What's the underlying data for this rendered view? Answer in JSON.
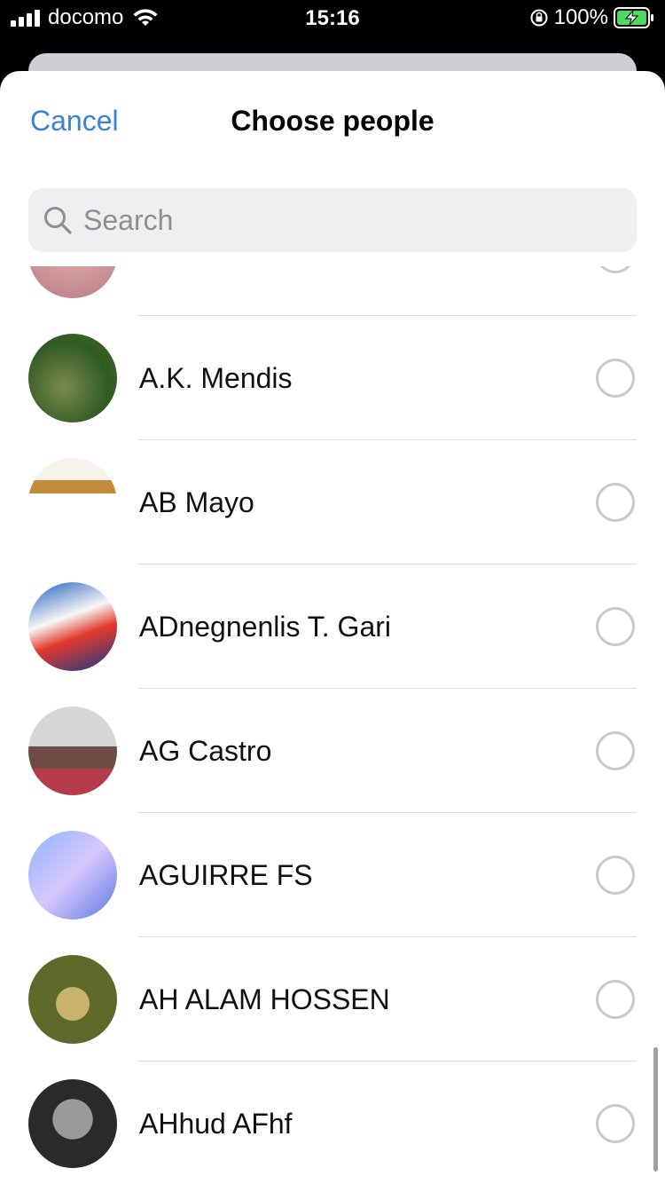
{
  "status_bar": {
    "carrier": "docomo",
    "time": "15:16",
    "battery": "100%"
  },
  "header": {
    "cancel_label": "Cancel",
    "title": "Choose people"
  },
  "search": {
    "placeholder": "Search",
    "value": ""
  },
  "contacts": [
    {
      "name": ""
    },
    {
      "name": "A.K. Mendis"
    },
    {
      "name": "AB Mayo"
    },
    {
      "name": "ADnegnenlis T. Gari"
    },
    {
      "name": "AG Castro"
    },
    {
      "name": "AGUIRRE FS"
    },
    {
      "name": "AH ALAM HOSSEN"
    },
    {
      "name": "AHhud AFhf"
    }
  ],
  "colors": {
    "accent": "#3a82d8",
    "search_bg": "#efeff0",
    "divider": "#dcdcdf",
    "radio_border": "#c8c8cc"
  },
  "icons": [
    "signal-icon",
    "wifi-icon",
    "orientation-lock-icon",
    "battery-charging-icon",
    "search-icon",
    "radio-unchecked-icon"
  ]
}
